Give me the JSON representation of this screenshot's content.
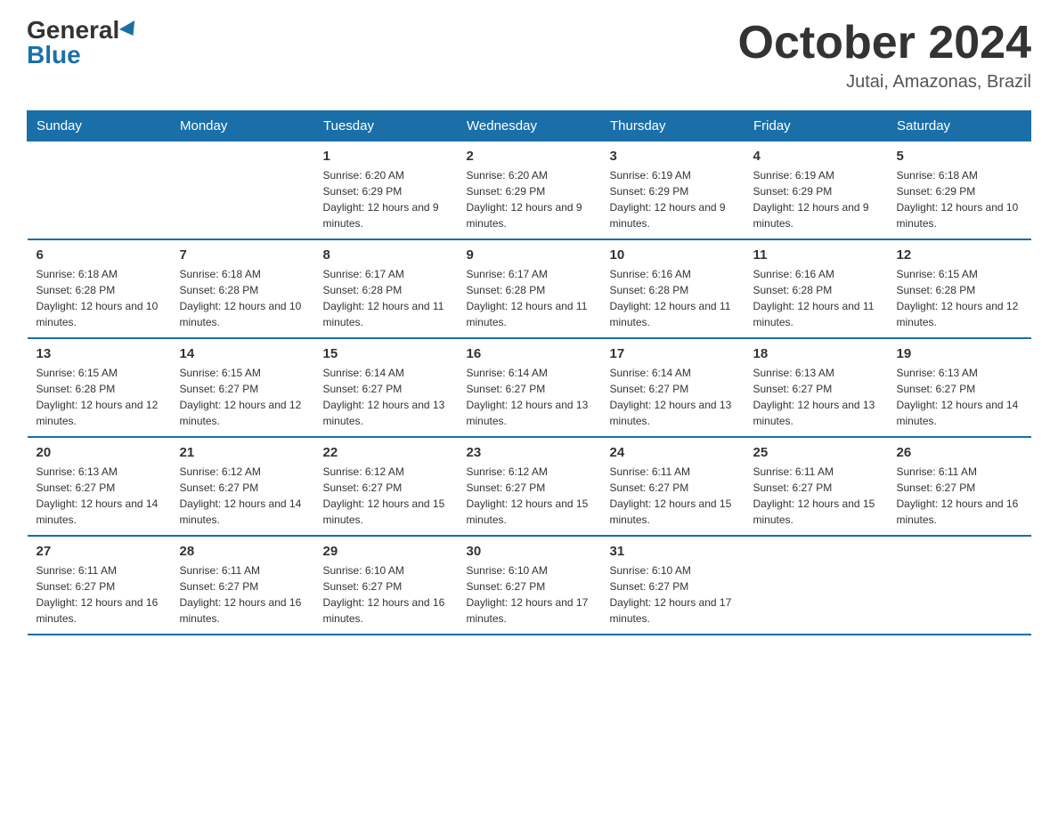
{
  "logo": {
    "general": "General",
    "blue": "Blue"
  },
  "title": "October 2024",
  "location": "Jutai, Amazonas, Brazil",
  "headers": [
    "Sunday",
    "Monday",
    "Tuesday",
    "Wednesday",
    "Thursday",
    "Friday",
    "Saturday"
  ],
  "weeks": [
    [
      {
        "day": "",
        "sunrise": "",
        "sunset": "",
        "daylight": ""
      },
      {
        "day": "",
        "sunrise": "",
        "sunset": "",
        "daylight": ""
      },
      {
        "day": "1",
        "sunrise": "Sunrise: 6:20 AM",
        "sunset": "Sunset: 6:29 PM",
        "daylight": "Daylight: 12 hours and 9 minutes."
      },
      {
        "day": "2",
        "sunrise": "Sunrise: 6:20 AM",
        "sunset": "Sunset: 6:29 PM",
        "daylight": "Daylight: 12 hours and 9 minutes."
      },
      {
        "day": "3",
        "sunrise": "Sunrise: 6:19 AM",
        "sunset": "Sunset: 6:29 PM",
        "daylight": "Daylight: 12 hours and 9 minutes."
      },
      {
        "day": "4",
        "sunrise": "Sunrise: 6:19 AM",
        "sunset": "Sunset: 6:29 PM",
        "daylight": "Daylight: 12 hours and 9 minutes."
      },
      {
        "day": "5",
        "sunrise": "Sunrise: 6:18 AM",
        "sunset": "Sunset: 6:29 PM",
        "daylight": "Daylight: 12 hours and 10 minutes."
      }
    ],
    [
      {
        "day": "6",
        "sunrise": "Sunrise: 6:18 AM",
        "sunset": "Sunset: 6:28 PM",
        "daylight": "Daylight: 12 hours and 10 minutes."
      },
      {
        "day": "7",
        "sunrise": "Sunrise: 6:18 AM",
        "sunset": "Sunset: 6:28 PM",
        "daylight": "Daylight: 12 hours and 10 minutes."
      },
      {
        "day": "8",
        "sunrise": "Sunrise: 6:17 AM",
        "sunset": "Sunset: 6:28 PM",
        "daylight": "Daylight: 12 hours and 11 minutes."
      },
      {
        "day": "9",
        "sunrise": "Sunrise: 6:17 AM",
        "sunset": "Sunset: 6:28 PM",
        "daylight": "Daylight: 12 hours and 11 minutes."
      },
      {
        "day": "10",
        "sunrise": "Sunrise: 6:16 AM",
        "sunset": "Sunset: 6:28 PM",
        "daylight": "Daylight: 12 hours and 11 minutes."
      },
      {
        "day": "11",
        "sunrise": "Sunrise: 6:16 AM",
        "sunset": "Sunset: 6:28 PM",
        "daylight": "Daylight: 12 hours and 11 minutes."
      },
      {
        "day": "12",
        "sunrise": "Sunrise: 6:15 AM",
        "sunset": "Sunset: 6:28 PM",
        "daylight": "Daylight: 12 hours and 12 minutes."
      }
    ],
    [
      {
        "day": "13",
        "sunrise": "Sunrise: 6:15 AM",
        "sunset": "Sunset: 6:28 PM",
        "daylight": "Daylight: 12 hours and 12 minutes."
      },
      {
        "day": "14",
        "sunrise": "Sunrise: 6:15 AM",
        "sunset": "Sunset: 6:27 PM",
        "daylight": "Daylight: 12 hours and 12 minutes."
      },
      {
        "day": "15",
        "sunrise": "Sunrise: 6:14 AM",
        "sunset": "Sunset: 6:27 PM",
        "daylight": "Daylight: 12 hours and 13 minutes."
      },
      {
        "day": "16",
        "sunrise": "Sunrise: 6:14 AM",
        "sunset": "Sunset: 6:27 PM",
        "daylight": "Daylight: 12 hours and 13 minutes."
      },
      {
        "day": "17",
        "sunrise": "Sunrise: 6:14 AM",
        "sunset": "Sunset: 6:27 PM",
        "daylight": "Daylight: 12 hours and 13 minutes."
      },
      {
        "day": "18",
        "sunrise": "Sunrise: 6:13 AM",
        "sunset": "Sunset: 6:27 PM",
        "daylight": "Daylight: 12 hours and 13 minutes."
      },
      {
        "day": "19",
        "sunrise": "Sunrise: 6:13 AM",
        "sunset": "Sunset: 6:27 PM",
        "daylight": "Daylight: 12 hours and 14 minutes."
      }
    ],
    [
      {
        "day": "20",
        "sunrise": "Sunrise: 6:13 AM",
        "sunset": "Sunset: 6:27 PM",
        "daylight": "Daylight: 12 hours and 14 minutes."
      },
      {
        "day": "21",
        "sunrise": "Sunrise: 6:12 AM",
        "sunset": "Sunset: 6:27 PM",
        "daylight": "Daylight: 12 hours and 14 minutes."
      },
      {
        "day": "22",
        "sunrise": "Sunrise: 6:12 AM",
        "sunset": "Sunset: 6:27 PM",
        "daylight": "Daylight: 12 hours and 15 minutes."
      },
      {
        "day": "23",
        "sunrise": "Sunrise: 6:12 AM",
        "sunset": "Sunset: 6:27 PM",
        "daylight": "Daylight: 12 hours and 15 minutes."
      },
      {
        "day": "24",
        "sunrise": "Sunrise: 6:11 AM",
        "sunset": "Sunset: 6:27 PM",
        "daylight": "Daylight: 12 hours and 15 minutes."
      },
      {
        "day": "25",
        "sunrise": "Sunrise: 6:11 AM",
        "sunset": "Sunset: 6:27 PM",
        "daylight": "Daylight: 12 hours and 15 minutes."
      },
      {
        "day": "26",
        "sunrise": "Sunrise: 6:11 AM",
        "sunset": "Sunset: 6:27 PM",
        "daylight": "Daylight: 12 hours and 16 minutes."
      }
    ],
    [
      {
        "day": "27",
        "sunrise": "Sunrise: 6:11 AM",
        "sunset": "Sunset: 6:27 PM",
        "daylight": "Daylight: 12 hours and 16 minutes."
      },
      {
        "day": "28",
        "sunrise": "Sunrise: 6:11 AM",
        "sunset": "Sunset: 6:27 PM",
        "daylight": "Daylight: 12 hours and 16 minutes."
      },
      {
        "day": "29",
        "sunrise": "Sunrise: 6:10 AM",
        "sunset": "Sunset: 6:27 PM",
        "daylight": "Daylight: 12 hours and 16 minutes."
      },
      {
        "day": "30",
        "sunrise": "Sunrise: 6:10 AM",
        "sunset": "Sunset: 6:27 PM",
        "daylight": "Daylight: 12 hours and 17 minutes."
      },
      {
        "day": "31",
        "sunrise": "Sunrise: 6:10 AM",
        "sunset": "Sunset: 6:27 PM",
        "daylight": "Daylight: 12 hours and 17 minutes."
      },
      {
        "day": "",
        "sunrise": "",
        "sunset": "",
        "daylight": ""
      },
      {
        "day": "",
        "sunrise": "",
        "sunset": "",
        "daylight": ""
      }
    ]
  ]
}
